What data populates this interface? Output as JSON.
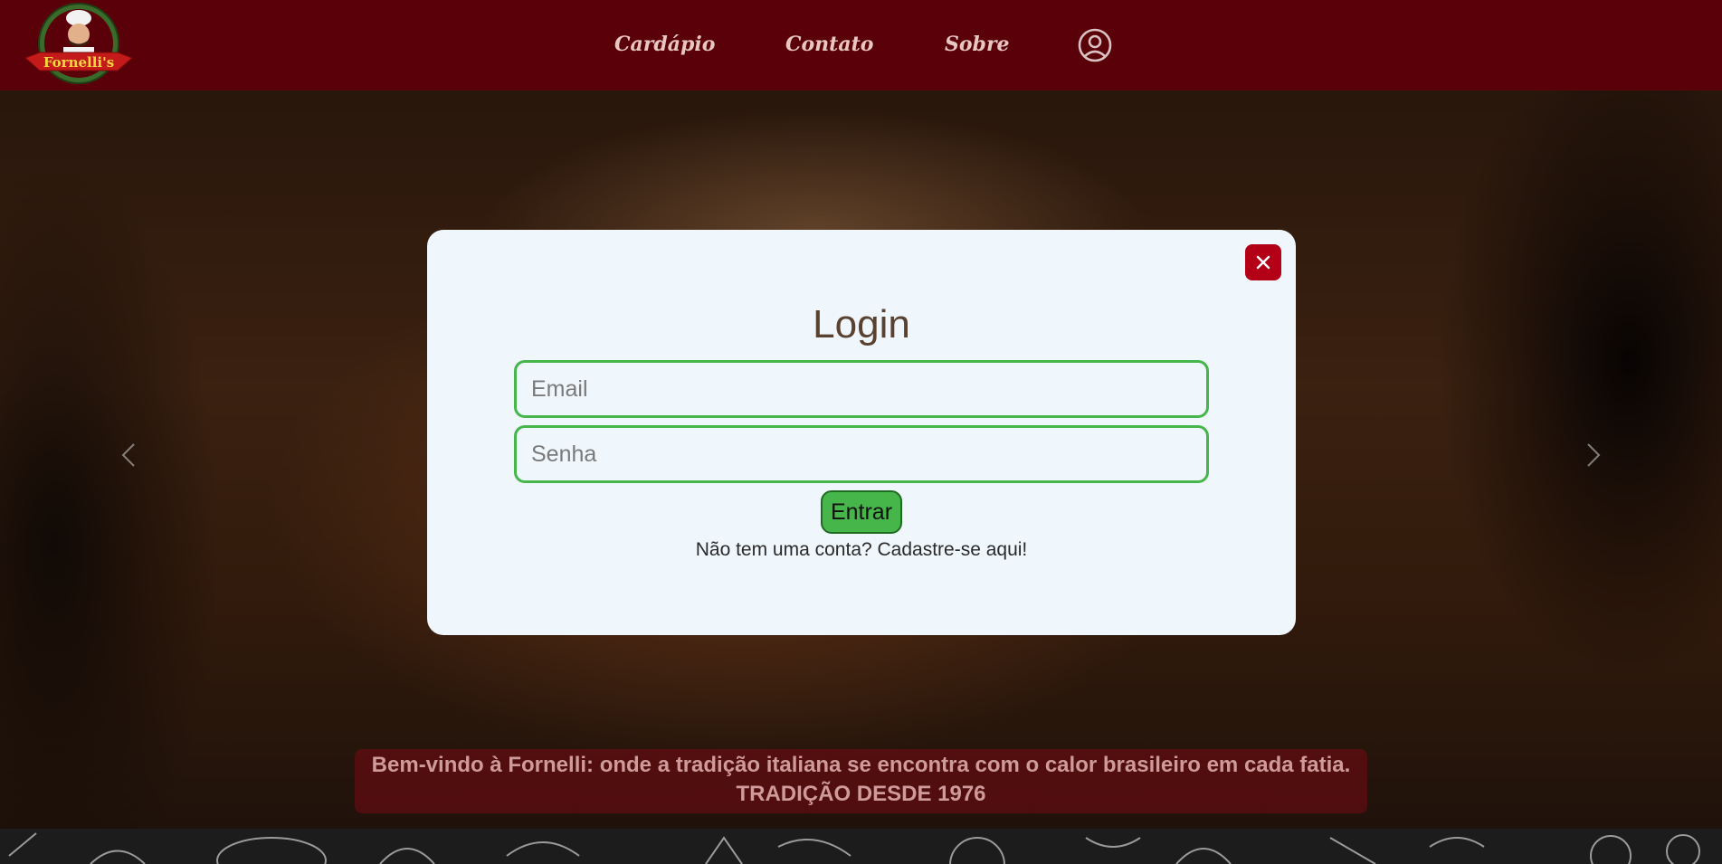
{
  "header": {
    "logo_text": "Fornelli's",
    "nav": {
      "cardapio": "Cardápio",
      "contato": "Contato",
      "sobre": "Sobre"
    },
    "user_icon": "user-circle-icon"
  },
  "hero": {
    "prev_icon": "chevron-left-icon",
    "next_icon": "chevron-right-icon",
    "banner": {
      "line1": "Bem-vindo à Fornelli: onde a tradição italiana se encontra com o calor brasileiro em cada fatia.",
      "line2": "TRADIÇÃO DESDE 1976"
    }
  },
  "modal": {
    "title": "Login",
    "email_placeholder": "Email",
    "senha_placeholder": "Senha",
    "submit_label": "Entrar",
    "signup_text": "Não tem uma conta? Cadastre-se aqui!",
    "close_icon": "close-icon"
  },
  "colors": {
    "header_bg": "#5a0008",
    "accent_green": "#46b54a",
    "close_red": "#b30017",
    "modal_bg": "#eff6fc"
  }
}
